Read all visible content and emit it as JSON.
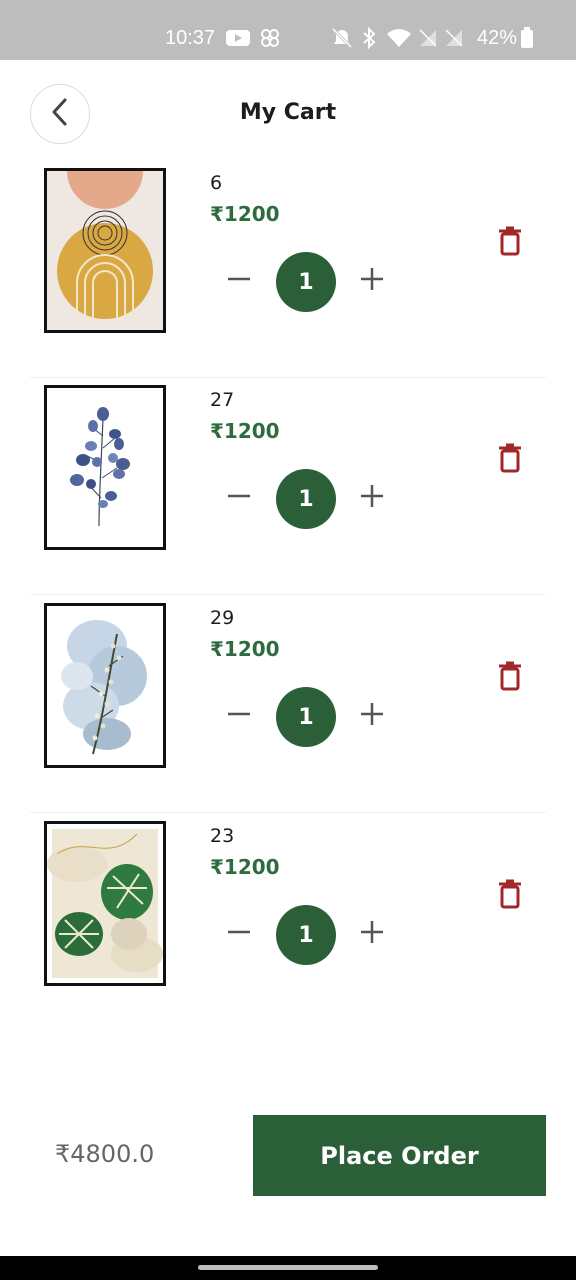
{
  "status_bar": {
    "time": "10:37",
    "battery": "42%",
    "icons": [
      "youtube-icon",
      "pinwheel-icon",
      "mute-icon",
      "bluetooth-icon",
      "wifi-icon",
      "no-signal-icon",
      "no-signal-icon",
      "battery-icon"
    ]
  },
  "header": {
    "title": "My Cart",
    "back_icon": "chevron-left-icon"
  },
  "items": [
    {
      "name": "6",
      "price": "₹1200",
      "quantity": "1",
      "art": "abstract-sun-arch"
    },
    {
      "name": "27",
      "price": "₹1200",
      "quantity": "1",
      "art": "blue-eucalyptus"
    },
    {
      "name": "29",
      "price": "₹1200",
      "quantity": "1",
      "art": "watercolor-branch"
    },
    {
      "name": "23",
      "price": "₹1200",
      "quantity": "1",
      "art": "monstera-leaves"
    }
  ],
  "footer": {
    "total": "₹4800.0",
    "place_order_label": "Place Order"
  },
  "colors": {
    "accent": "#2b5f38",
    "price": "#2e6b3f",
    "delete": "#a3262a",
    "status_bar": "#bdbdbd"
  }
}
